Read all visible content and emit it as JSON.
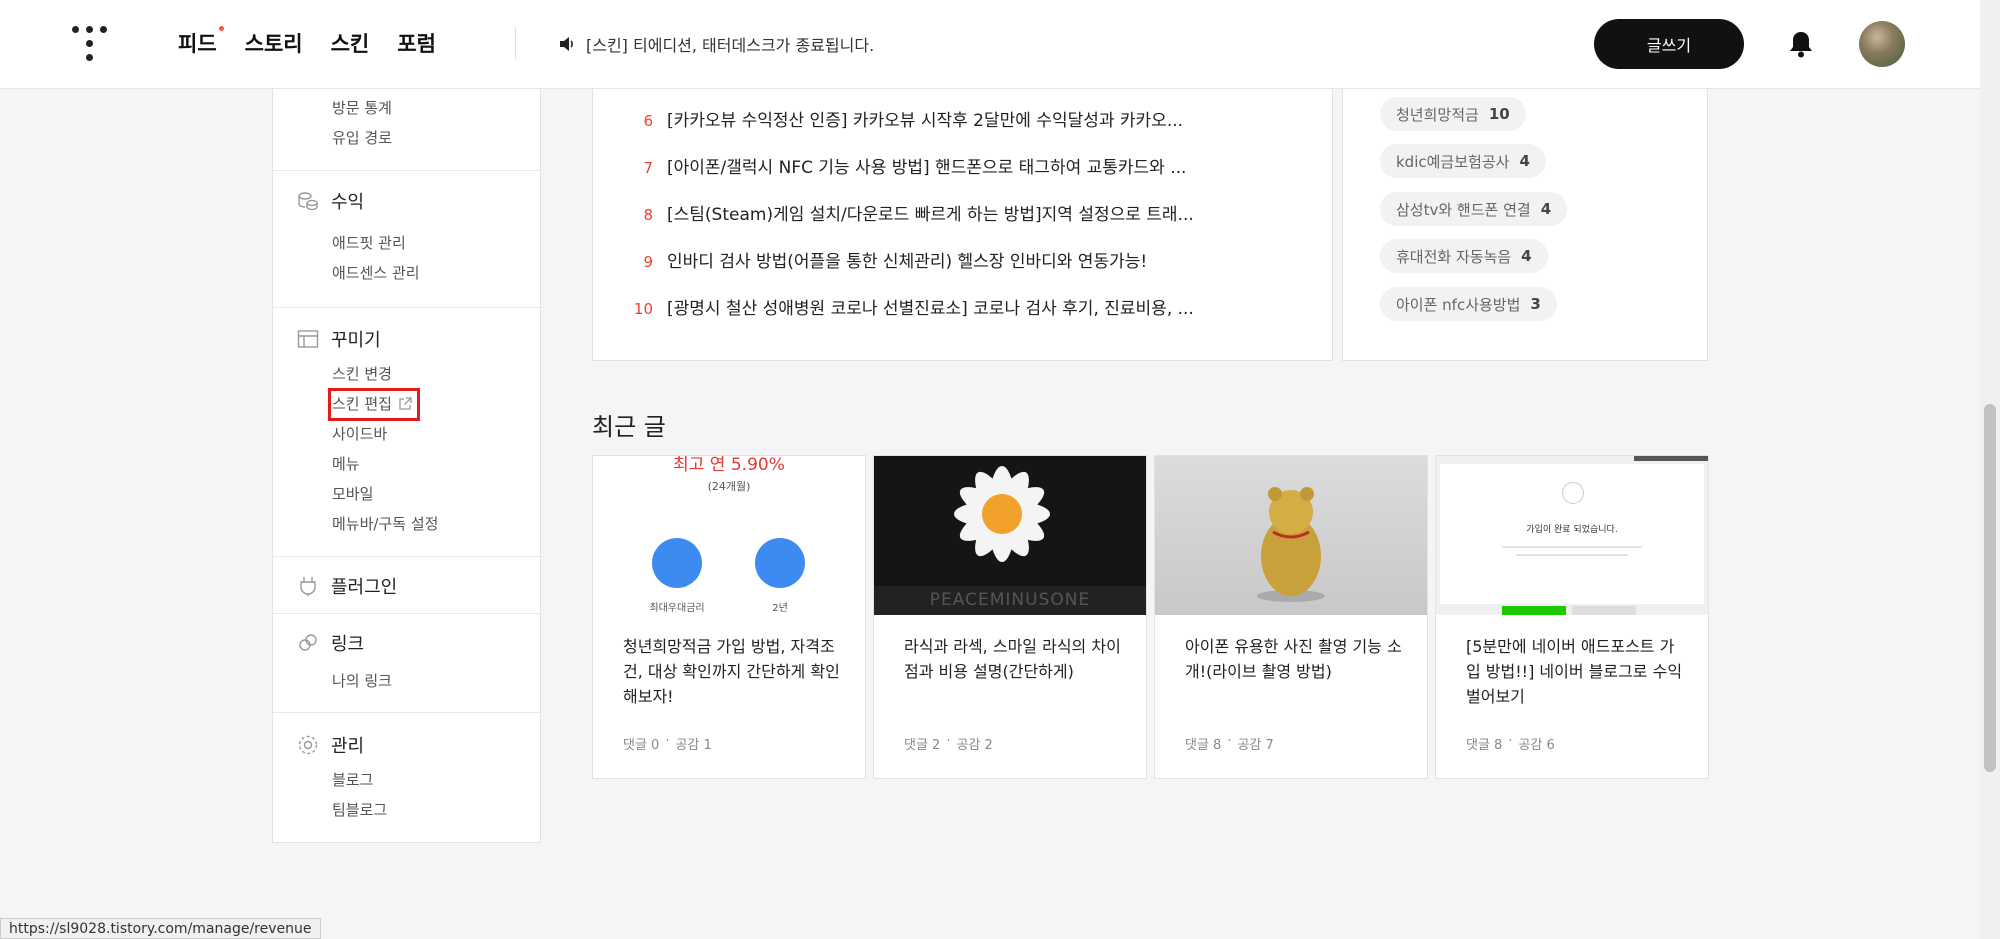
{
  "header": {
    "nav": [
      "피드",
      "스토리",
      "스킨",
      "포럼"
    ],
    "notice": "[스킨] 티에디션, 태터데스크가 종료됩니다.",
    "write_label": "글쓰기"
  },
  "sidebar": {
    "top_links": [
      "방문 통계",
      "유입 경로"
    ],
    "groups": [
      {
        "title": "수익",
        "icon": "coins-icon",
        "items": [
          "애드핏 관리",
          "애드센스 관리"
        ]
      },
      {
        "title": "꾸미기",
        "icon": "layout-icon",
        "items": [
          "스킨 변경",
          "스킨 편집",
          "사이드바",
          "메뉴",
          "모바일",
          "메뉴바/구독 설정"
        ]
      },
      {
        "title": "플러그인",
        "icon": "plug-icon",
        "items": []
      },
      {
        "title": "링크",
        "icon": "link-icon",
        "items": [
          "나의 링크"
        ]
      },
      {
        "title": "관리",
        "icon": "gear-icon",
        "items": [
          "블로그",
          "팀블로그"
        ]
      }
    ]
  },
  "popular": [
    {
      "rank": "6",
      "title": "[카카오뷰 수익정산 인증] 카카오뷰 시작후 2달만에 수익달성과 카카오..."
    },
    {
      "rank": "7",
      "title": "[아이폰/갤럭시 NFC 기능 사용 방법] 핸드폰으로 태그하여 교통카드와 ..."
    },
    {
      "rank": "8",
      "title": "[스팀(Steam)게임 설치/다운로드 빠르게 하는 방법]지역 설정으로 트래..."
    },
    {
      "rank": "9",
      "title": "인바디 검사 방법(어플을 통한 신체관리) 헬스장 인바디와 연동가능!"
    },
    {
      "rank": "10",
      "title": "[광명시 철산 성애병원 코로나 선별진료소] 코로나 검사 후기, 진료비용, ..."
    }
  ],
  "tags": [
    {
      "name": "청년희망적금",
      "count": "10"
    },
    {
      "name": "kdic예금보험공사",
      "count": "4"
    },
    {
      "name": "삼성tv와 핸드폰 연결",
      "count": "4"
    },
    {
      "name": "휴대전화 자동녹음",
      "count": "4"
    },
    {
      "name": "아이폰 nfc사용방법",
      "count": "3"
    }
  ],
  "recent": {
    "title": "최근 글",
    "posts": [
      {
        "title": "청년희망적금 가입 방법, 자격조건, 대상 확인까지 간단하게 확인해보자!",
        "comments": "댓글 0",
        "likes": "공감 1",
        "thumb": {
          "rate": "최고 연 5.90%",
          "period": "(24개월)",
          "label_a": "최대우대금리",
          "label_b": "2년"
        }
      },
      {
        "title": "라식과 라섹, 스마일 라식의 차이점과 비용 설명(간단하게)",
        "comments": "댓글 2",
        "likes": "공감 2",
        "thumb": {
          "caption": "PEACEMINUSONE"
        }
      },
      {
        "title": "아이폰 유용한 사진 촬영 기능 소개!(라이브 촬영 방법)",
        "comments": "댓글 8",
        "likes": "공감 7"
      },
      {
        "title": "[5분만에 네이버 애드포스트 가입 방법!!] 네이버 블로그로 수익 벌어보기",
        "comments": "댓글 8",
        "likes": "공감 6",
        "thumb": {
          "message": "가입이 완료 되었습니다."
        }
      }
    ]
  },
  "status_url": "https://sl9028.tistory.com/manage/revenue"
}
